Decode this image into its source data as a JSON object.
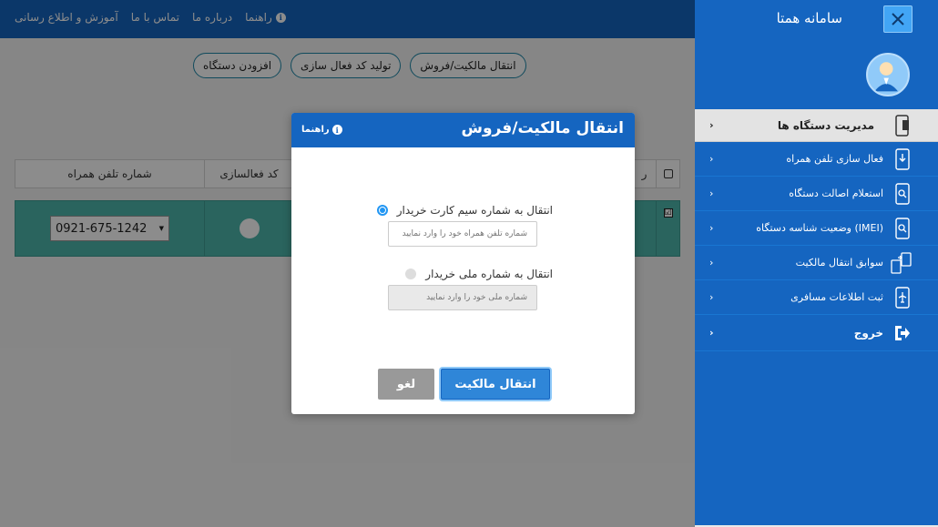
{
  "app": {
    "title": "سامانه همتا"
  },
  "topnav": {
    "items": [
      {
        "label": "راهنما",
        "icon": "info-icon"
      },
      {
        "label": "درباره ما"
      },
      {
        "label": "تماس با ما"
      },
      {
        "label": "آموزش و اطلاع رسانی"
      }
    ]
  },
  "actions": {
    "transfer": "انتقال مالکیت/فروش",
    "generate_code": "تولید کد فعال سازی",
    "add_device": "افزودن دستگاه"
  },
  "table": {
    "columns": {
      "row": "ر",
      "activation_code": "کد فعالسازی",
      "phone": "شماره تلفن همراه"
    },
    "rows": [
      {
        "phone_selected": "0921-675-1242",
        "checked": "☑"
      }
    ]
  },
  "sidebar": {
    "header": "مدیریت دستگاه ها",
    "items": [
      {
        "label": "فعال سازی تلفن همراه",
        "icon": "phone-download-icon"
      },
      {
        "label": "استعلام اصالت دستگاه",
        "icon": "phone-search-icon"
      },
      {
        "label": "وضعیت شناسه دستگاه (IMEI)",
        "icon": "phone-search-icon"
      },
      {
        "label": "سوابق انتقال مالکیت",
        "icon": "transfer-devices-icon"
      },
      {
        "label": "ثبت اطلاعات مسافری",
        "icon": "phone-plane-icon"
      }
    ],
    "exit": "خروج"
  },
  "modal": {
    "title": "انتقال مالکیت/فروش",
    "help": "راهنما",
    "option_sim": {
      "label": "انتقال به شماره سیم کارت خریدار",
      "placeholder": "شماره تلفن همراه خود را وارد نمایید",
      "selected": true
    },
    "option_national": {
      "label": "انتقال به شماره ملی خریدار",
      "placeholder": "شماره ملی خود را وارد نمایید",
      "selected": false
    },
    "submit": "انتقال مالکیت",
    "cancel": "لغو"
  },
  "colors": {
    "primary": "#1565c0",
    "accent": "#2196f3",
    "row_highlight": "#4db6ac"
  }
}
